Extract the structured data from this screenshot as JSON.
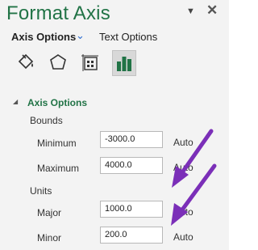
{
  "pane": {
    "title": "Format Axis",
    "dropdown_icon": "chevron-down-icon",
    "close_label": "✕"
  },
  "tabs": {
    "axis_options": "Axis Options",
    "text_options": "Text Options"
  },
  "icons": [
    "fill-line-icon",
    "effects-pentagon-icon",
    "size-properties-icon",
    "axis-options-bar-chart-icon"
  ],
  "section": {
    "title": "Axis Options",
    "bounds_label": "Bounds",
    "units_label": "Units"
  },
  "fields": {
    "minimum": {
      "label": "Minimum",
      "value": "-3000.0",
      "auto": "Auto"
    },
    "maximum": {
      "label": "Maximum",
      "value": "4000.0",
      "auto": "Auto"
    },
    "major": {
      "label": "Major",
      "value": "1000.0",
      "auto": "Auto"
    },
    "minor": {
      "label": "Minor",
      "value": "200.0",
      "auto": "Auto"
    }
  },
  "colors": {
    "accent": "#217346",
    "arrow": "#7b2fb8"
  }
}
